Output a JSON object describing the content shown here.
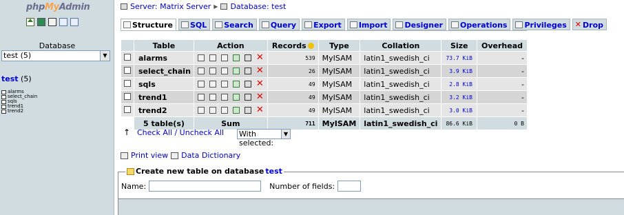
{
  "left": {
    "logo_php": "php",
    "logo_my": "My",
    "logo_admin": "Admin",
    "icons": [
      "home-icon",
      "sql-icon",
      "database-icon",
      "query-window-icon",
      "docs-icon"
    ],
    "database_label": "Database",
    "database_select": "test (5)",
    "db_heading_name": "test",
    "db_heading_count": "(5)",
    "tables": [
      "alarms",
      "select_chain",
      "sqls",
      "trend1",
      "trend2"
    ]
  },
  "breadcrumb": {
    "server": "Server: Matrix Server",
    "database": "Database: test"
  },
  "tabs": [
    {
      "label": "Structure",
      "active": true
    },
    {
      "label": "SQL"
    },
    {
      "label": "Search"
    },
    {
      "label": "Query"
    },
    {
      "label": "Export"
    },
    {
      "label": "Import"
    },
    {
      "label": "Designer"
    },
    {
      "label": "Operations"
    },
    {
      "label": "Privileges"
    },
    {
      "label": "Drop"
    }
  ],
  "table": {
    "headers": [
      "Table",
      "Action",
      "Records",
      "Type",
      "Collation",
      "Size",
      "Overhead"
    ],
    "rows": [
      {
        "name": "alarms",
        "records": "539",
        "type": "MyISAM",
        "collation": "latin1_swedish_ci",
        "size": "73.7 KiB",
        "overhead": "-"
      },
      {
        "name": "select_chain",
        "records": "26",
        "type": "MyISAM",
        "collation": "latin1_swedish_ci",
        "size": "3.9 KiB",
        "overhead": "-"
      },
      {
        "name": "sqls",
        "records": "49",
        "type": "MyISAM",
        "collation": "latin1_swedish_ci",
        "size": "2.8 KiB",
        "overhead": "-"
      },
      {
        "name": "trend1",
        "records": "49",
        "type": "MyISAM",
        "collation": "latin1_swedish_ci",
        "size": "3.2 KiB",
        "overhead": "-"
      },
      {
        "name": "trend2",
        "records": "49",
        "type": "MyISAM",
        "collation": "latin1_swedish_ci",
        "size": "3.0 KiB",
        "overhead": "-"
      }
    ],
    "footer": {
      "tables": "5 table(s)",
      "sum": "Sum",
      "records": "711",
      "type": "MyISAM",
      "collation": "latin1_swedish_ci",
      "size": "86.6 KiB",
      "overhead": "0 B"
    }
  },
  "check_all": "Check All / Uncheck All",
  "with_selected": "With selected:",
  "print_view": "Print view",
  "data_dictionary": "Data Dictionary",
  "create_table": {
    "legend_prefix": "Create new table on database",
    "legend_db": "test",
    "name_label": "Name:",
    "fields_label": "Number of fields:"
  },
  "colors": {
    "frame_bg": "#d0dce0",
    "link": "#0000cc",
    "row_odd": "#e5e5e5",
    "row_even": "#d5d5d5",
    "drop": "#e00000"
  }
}
